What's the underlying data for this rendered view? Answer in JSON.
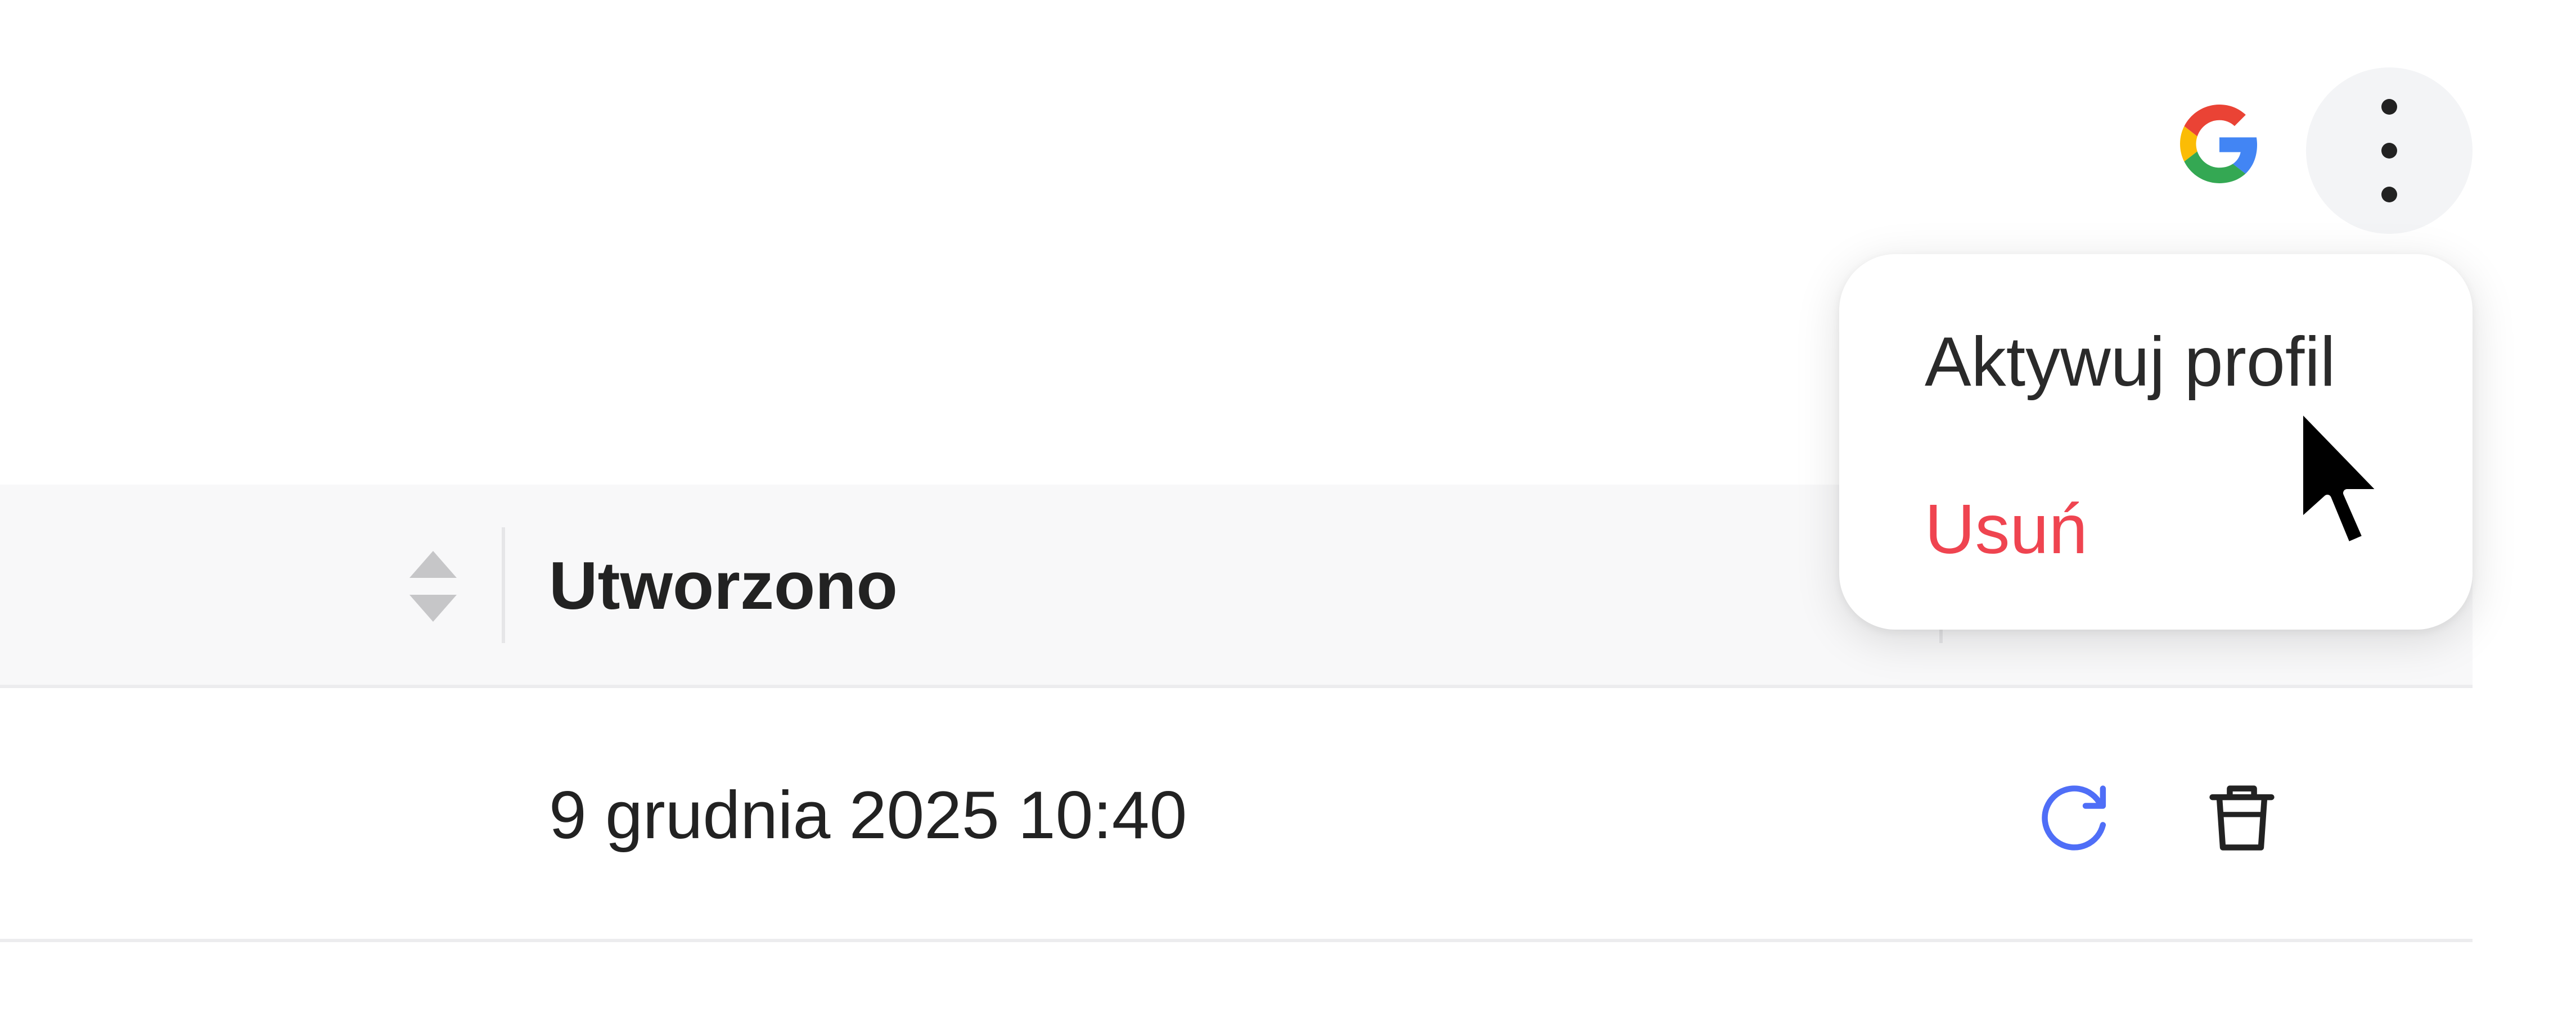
{
  "toolbar": {
    "provider_icon": "google-icon",
    "more_icon": "more-vertical-icon"
  },
  "table": {
    "sort_icon": "sort-icon",
    "columns": [
      {
        "label": "Utworzono"
      }
    ],
    "rows": [
      {
        "created": "9 grudnia 2025 10:40",
        "actions": [
          "refresh-icon",
          "trash-icon"
        ]
      }
    ]
  },
  "menu": {
    "items": [
      {
        "label": "Aktywuj profil"
      },
      {
        "label": "Usuń",
        "color": "#ef4450"
      }
    ]
  },
  "colors": {
    "accent_blue": "#4f6ef7",
    "danger_red": "#ef4450",
    "header_bg": "#f8f8f9",
    "more_button_bg": "#f3f4f6"
  }
}
